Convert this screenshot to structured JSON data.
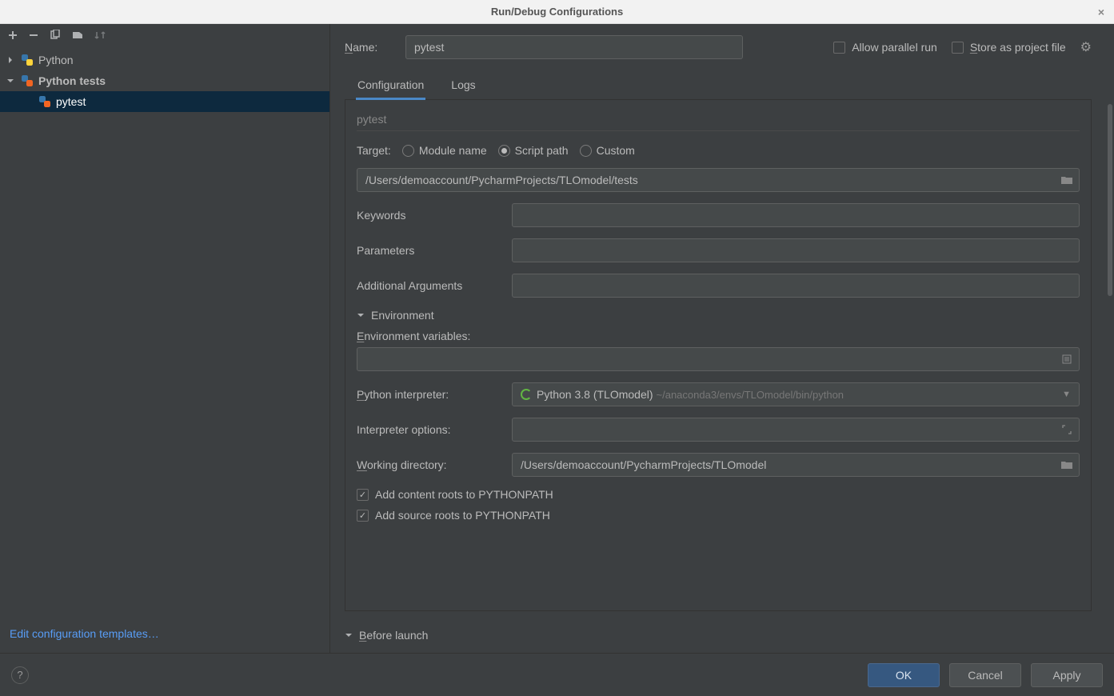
{
  "dialog": {
    "title": "Run/Debug Configurations"
  },
  "tree": {
    "python": "Python",
    "python_tests": "Python tests",
    "pytest": "pytest"
  },
  "sidebar": {
    "edit_templates": "Edit configuration templates…"
  },
  "top": {
    "name_label": "Name:",
    "name_value": "pytest",
    "allow_parallel": "Allow parallel run",
    "store_project": "Store as project file"
  },
  "tabs": {
    "configuration": "Configuration",
    "logs": "Logs"
  },
  "panel": {
    "section_label": "pytest",
    "target_label": "Target:",
    "radio_module": "Module name",
    "radio_script": "Script path",
    "radio_custom": "Custom",
    "target_path": "/Users/demoaccount/PycharmProjects/TLOmodel/tests",
    "keywords_label": "Keywords",
    "keywords_value": "",
    "params_label": "Parameters",
    "params_value": "",
    "addargs_label": "Additional Arguments",
    "addargs_value": "",
    "env_header": "Environment",
    "env_vars_label": "Environment variables:",
    "env_vars_value": "",
    "interpreter_label": "Python interpreter:",
    "interpreter_main": "Python 3.8 (TLOmodel)",
    "interpreter_path": "~/anaconda3/envs/TLOmodel/bin/python",
    "interp_opts_label": "Interpreter options:",
    "interp_opts_value": "",
    "workdir_label": "Working directory:",
    "workdir_value": "/Users/demoaccount/PycharmProjects/TLOmodel",
    "check_content_roots": "Add content roots to PYTHONPATH",
    "check_source_roots": "Add source roots to PYTHONPATH",
    "before_launch": "Before launch"
  },
  "footer": {
    "ok": "OK",
    "cancel": "Cancel",
    "apply": "Apply"
  }
}
